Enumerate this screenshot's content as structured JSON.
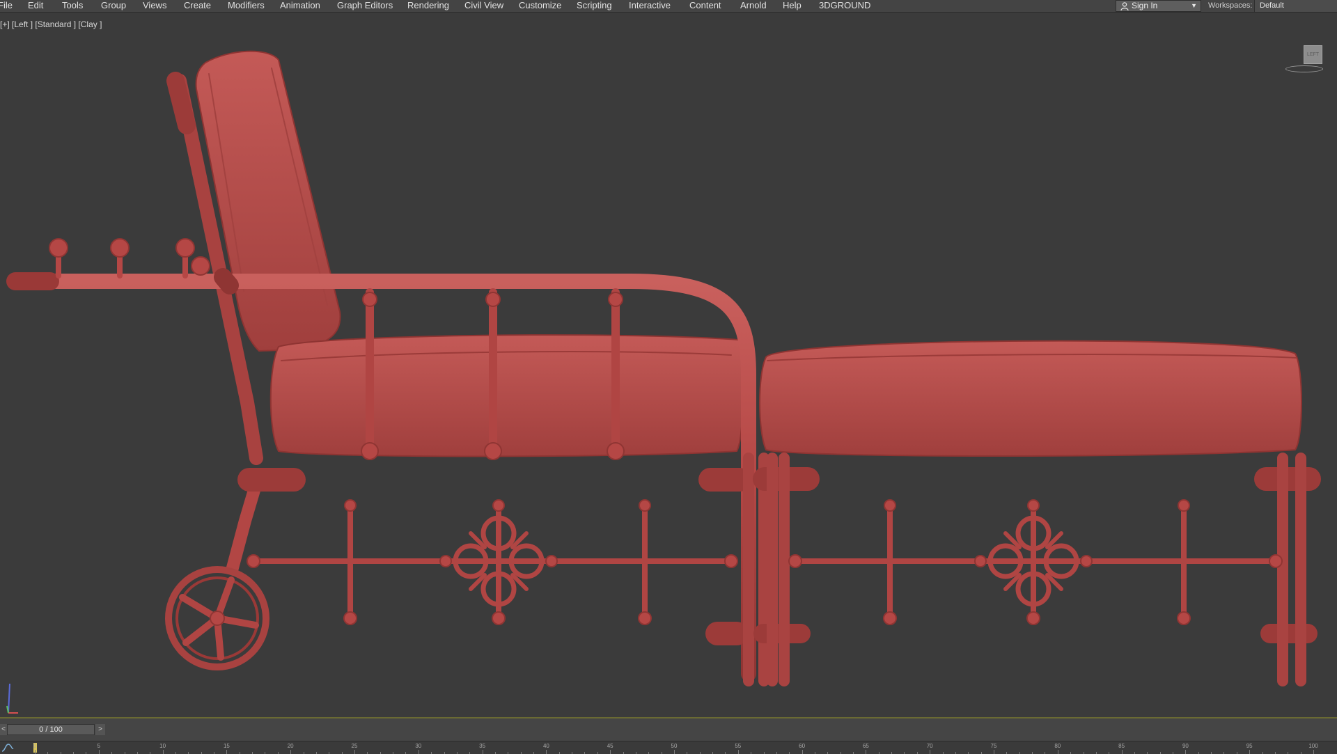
{
  "menu": [
    {
      "label": "File"
    },
    {
      "label": "Edit"
    },
    {
      "label": "Tools"
    },
    {
      "label": "Group"
    },
    {
      "label": "Views"
    },
    {
      "label": "Create"
    },
    {
      "label": "Modifiers"
    },
    {
      "label": "Animation"
    },
    {
      "label": "Graph Editors"
    },
    {
      "label": "Rendering"
    },
    {
      "label": "Civil View"
    },
    {
      "label": "Customize"
    },
    {
      "label": "Scripting"
    },
    {
      "label": "Interactive"
    },
    {
      "label": "Content"
    },
    {
      "label": "Arnold"
    },
    {
      "label": "Help"
    },
    {
      "label": "3DGROUND"
    }
  ],
  "account": {
    "sign_in_label": "Sign In"
  },
  "workspaces": {
    "label": "Workspaces:",
    "value": "Default"
  },
  "viewport": {
    "label": "[+] [Left ] [Standard ] [Clay ]",
    "viewcube_face": "LEFT",
    "model_color": "#b54745",
    "background": "#3b3b3b"
  },
  "timeline": {
    "position_label": "0 / 100",
    "prev_label": "<",
    "next_label": ">",
    "ticks": [
      "0",
      "5",
      "10",
      "15",
      "20",
      "25",
      "30",
      "35",
      "40",
      "45",
      "50",
      "55",
      "60",
      "65",
      "70",
      "75",
      "80",
      "85",
      "90",
      "95",
      "100"
    ],
    "current_frame": 0
  }
}
